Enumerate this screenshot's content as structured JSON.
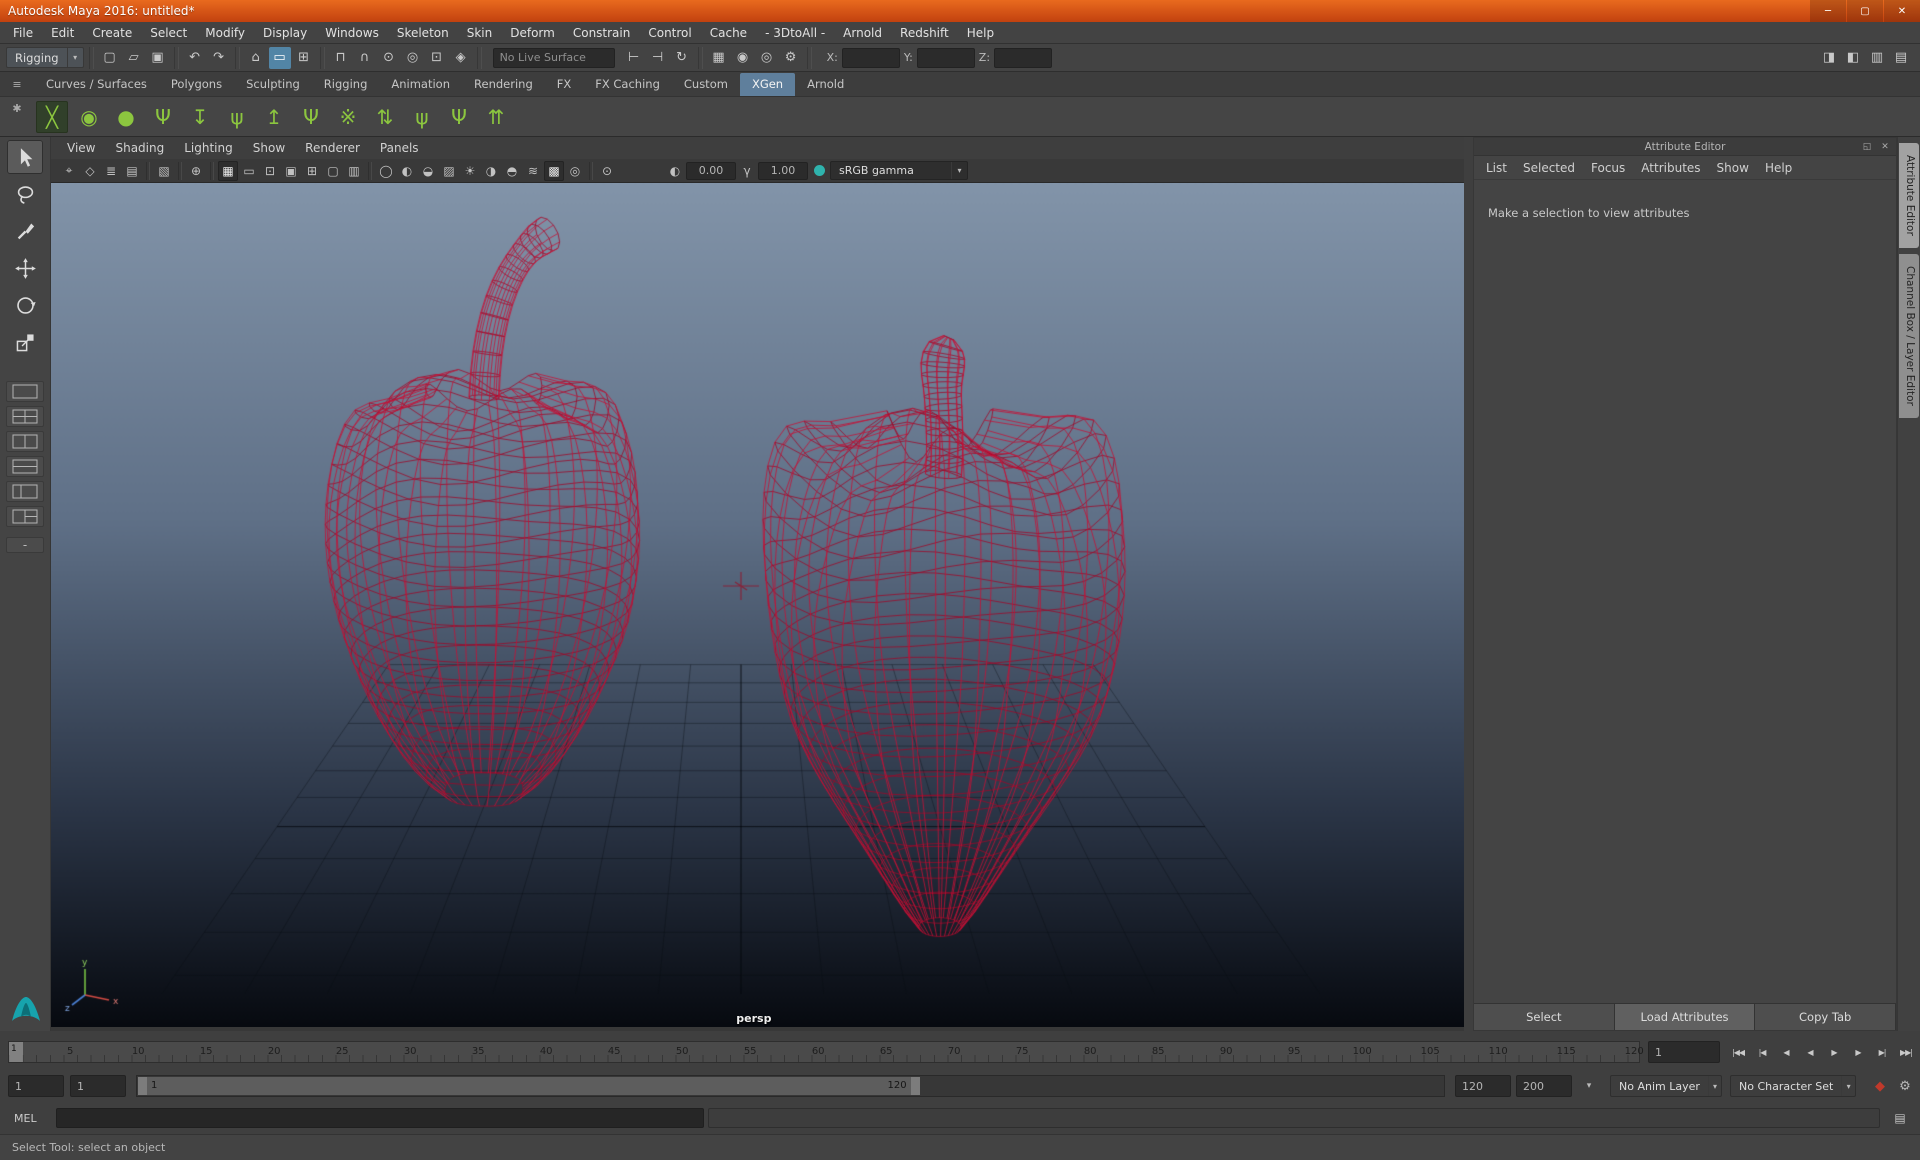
{
  "window": {
    "title": "Autodesk Maya 2016: untitled*",
    "minimize": "─",
    "maximize": "▢",
    "close": "✕"
  },
  "glyphs": {
    "chevron_down": "▾",
    "float_panel": "◱",
    "close_small": "✕",
    "shelf_menu": "≡",
    "shelf_gear": "✱"
  },
  "menubar": [
    "File",
    "Edit",
    "Create",
    "Select",
    "Modify",
    "Display",
    "Windows",
    "Skeleton",
    "Skin",
    "Deform",
    "Constrain",
    "Control",
    "Cache",
    "- 3DtoAll -",
    "Arnold",
    "Redshift",
    "Help"
  ],
  "toolbar": {
    "menuset": "Rigging",
    "groups": [
      [
        {
          "name": "new-scene-icon",
          "glyph": "▢"
        },
        {
          "name": "open-scene-icon",
          "glyph": "▱"
        },
        {
          "name": "save-scene-icon",
          "glyph": "▣"
        }
      ],
      [
        {
          "name": "undo-icon",
          "glyph": "↶"
        },
        {
          "name": "redo-icon",
          "glyph": "↷"
        }
      ],
      [
        {
          "name": "select-by-hierarchy-icon",
          "glyph": "⌂"
        },
        {
          "name": "select-by-object-icon",
          "glyph": "▭",
          "active": true
        },
        {
          "name": "select-by-component-icon",
          "glyph": "⊞"
        }
      ],
      [
        {
          "name": "snap-to-grid-icon",
          "glyph": "⊓"
        },
        {
          "name": "snap-to-curve-icon",
          "glyph": "∩"
        },
        {
          "name": "snap-to-point-icon",
          "glyph": "⊙"
        },
        {
          "name": "snap-to-projected-center-icon",
          "glyph": "◎"
        },
        {
          "name": "snap-to-view-plane-icon",
          "glyph": "⊡"
        },
        {
          "name": "make-live-icon",
          "glyph": "◈"
        }
      ]
    ],
    "live_surface": "No Live Surface",
    "groups2": [
      [
        {
          "name": "input-connections-icon",
          "glyph": "⊢"
        },
        {
          "name": "output-connections-icon",
          "glyph": "⊣"
        },
        {
          "name": "construction-history-icon",
          "glyph": "↻"
        }
      ],
      [
        {
          "name": "render-view-icon",
          "glyph": "▦"
        },
        {
          "name": "render-current-frame-icon",
          "glyph": "◉"
        },
        {
          "name": "ipr-render-icon",
          "glyph": "◎"
        },
        {
          "name": "render-settings-icon",
          "glyph": "⚙"
        }
      ]
    ],
    "coords": {
      "x_label": "X:",
      "y_label": "Y:",
      "z_label": "Z:",
      "x_value": "",
      "y_value": "",
      "z_value": ""
    },
    "right_icons": [
      {
        "name": "toggle-modeling-toolkit-icon",
        "glyph": "◨"
      },
      {
        "name": "toggle-attribute-editor-icon",
        "glyph": "◧"
      },
      {
        "name": "toggle-tool-settings-icon",
        "glyph": "▥"
      },
      {
        "name": "toggle-channel-box-icon",
        "glyph": "▤"
      }
    ]
  },
  "shelf": {
    "tabs": [
      "Curves / Surfaces",
      "Polygons",
      "Sculpting",
      "Rigging",
      "Animation",
      "Rendering",
      "FX",
      "FX Caching",
      "Custom",
      "XGen",
      "Arnold"
    ],
    "active_tab": "XGen",
    "icons": [
      {
        "name": "xgen-create-description-icon",
        "glyph": "╳",
        "boxed": true
      },
      {
        "name": "xgen-update-preview-icon",
        "glyph": "◉"
      },
      {
        "name": "xgen-sphere-brush-icon",
        "glyph": "●"
      },
      {
        "name": "xgen-add-guides-icon",
        "glyph": "Ψ"
      },
      {
        "name": "xgen-place-guides-icon",
        "glyph": "↧"
      },
      {
        "name": "xgen-comb-guides-icon",
        "glyph": "ψ"
      },
      {
        "name": "xgen-lift-guides-icon",
        "glyph": "↥"
      },
      {
        "name": "xgen-edit-guides-icon",
        "glyph": "Ψ"
      },
      {
        "name": "xgen-density-brush-icon",
        "glyph": "※"
      },
      {
        "name": "xgen-convert-to-poly-icon",
        "glyph": "⇅"
      },
      {
        "name": "xgen-grass-preset-icon",
        "glyph": "ψ"
      },
      {
        "name": "xgen-groomable-spline-icon",
        "glyph": "Ψ"
      },
      {
        "name": "xgen-export-patches-icon",
        "glyph": "⇈"
      }
    ]
  },
  "toolbox": {
    "tools": [
      {
        "name": "select-tool",
        "active": true
      },
      {
        "name": "lasso-tool"
      },
      {
        "name": "paint-selection-tool"
      },
      {
        "name": "move-tool"
      },
      {
        "name": "rotate-tool"
      },
      {
        "name": "scale-tool"
      }
    ],
    "layouts": [
      "layout-single-pane",
      "layout-four-view",
      "layout-two-side-by-side",
      "layout-two-stacked",
      "layout-persp-outliner",
      "layout-split-right"
    ],
    "collapse_label": "-"
  },
  "panel": {
    "menus": [
      "View",
      "Shading",
      "Lighting",
      "Show",
      "Renderer",
      "Panels"
    ],
    "icons": [
      {
        "name": "select-camera-icon",
        "glyph": "⌖"
      },
      {
        "name": "lock-camera-icon",
        "glyph": "◇"
      },
      {
        "name": "camera-attributes-icon",
        "glyph": "≣"
      },
      {
        "name": "bookmarks-icon",
        "glyph": "▤"
      },
      {
        "sep": true
      },
      {
        "name": "image-plane-icon",
        "glyph": "▧"
      },
      {
        "sep": true
      },
      {
        "name": "2d-pan-zoom-icon",
        "glyph": "⊕"
      },
      {
        "sep": true
      },
      {
        "name": "grid-icon",
        "glyph": "▦",
        "active": true
      },
      {
        "name": "film-gate-icon",
        "glyph": "▭"
      },
      {
        "name": "resolution-gate-icon",
        "glyph": "⊡"
      },
      {
        "name": "gate-mask-icon",
        "glyph": "▣"
      },
      {
        "name": "field-chart-icon",
        "glyph": "⊞"
      },
      {
        "name": "safe-action-icon",
        "glyph": "▢"
      },
      {
        "name": "safe-title-icon",
        "glyph": "▥"
      },
      {
        "sep": true
      },
      {
        "name": "wireframe-icon",
        "glyph": "◯"
      },
      {
        "name": "smooth-shade-icon",
        "glyph": "◐"
      },
      {
        "name": "wireframe-on-shaded-icon",
        "glyph": "◒"
      },
      {
        "name": "textured-icon",
        "glyph": "▨"
      },
      {
        "name": "use-all-lights-icon",
        "glyph": "☀"
      },
      {
        "name": "shadows-icon",
        "glyph": "◑"
      },
      {
        "name": "screen-space-ao-icon",
        "glyph": "◓"
      },
      {
        "name": "motion-blur-icon",
        "glyph": "≋"
      },
      {
        "name": "multisample-icon",
        "glyph": "▩",
        "active": true
      },
      {
        "name": "depth-of-field-icon",
        "glyph": "◎"
      },
      {
        "sep": true
      },
      {
        "name": "isolate-select-icon",
        "glyph": "⊙"
      }
    ],
    "exposure_icon": "◐",
    "exposure": "0.00",
    "gamma_icon": "γ",
    "gamma": "1.00",
    "view_transform": "sRGB gamma",
    "camera": "persp"
  },
  "attribute_editor": {
    "title": "Attribute Editor",
    "menus": [
      "List",
      "Selected",
      "Focus",
      "Attributes",
      "Show",
      "Help"
    ],
    "message": "Make a selection to view attributes",
    "buttons": [
      {
        "label": "Select"
      },
      {
        "label": "Load Attributes",
        "active": true
      },
      {
        "label": "Copy Tab"
      }
    ]
  },
  "right_tabs": [
    {
      "label": "Attribute Editor",
      "active": true
    },
    {
      "label": "Channel Box / Layer Editor"
    }
  ],
  "timeline": {
    "tick_labels": [
      "5",
      "10",
      "15",
      "20",
      "25",
      "30",
      "35",
      "40",
      "45",
      "50",
      "55",
      "60",
      "65",
      "70",
      "75",
      "80",
      "85",
      "90",
      "95",
      "100",
      "105",
      "110",
      "115",
      "120"
    ],
    "playhead": "1",
    "current_frame": "1",
    "playback": [
      {
        "name": "go-to-start-button",
        "glyph": "|◀◀"
      },
      {
        "name": "step-back-frame-button",
        "glyph": "|◀"
      },
      {
        "name": "step-back-key-button",
        "glyph": "◀"
      },
      {
        "name": "play-backwards-button",
        "glyph": "◀"
      },
      {
        "name": "play-forwards-button",
        "glyph": "▶"
      },
      {
        "name": "step-forward-key-button",
        "glyph": "▶"
      },
      {
        "name": "step-forward-frame-button",
        "glyph": "▶|"
      },
      {
        "name": "go-to-end-button",
        "glyph": "▶▶|"
      }
    ]
  },
  "range_slider": {
    "anim_start": "1",
    "playback_start": "1",
    "bar_start_label": "1",
    "bar_end_label": "120",
    "playback_end": "120",
    "anim_end": "200",
    "menu_glyph": "▾",
    "anim_layer": "No Anim Layer",
    "character_set": "No Character Set",
    "icons": [
      {
        "name": "auto-keyframe-icon",
        "glyph": "◆",
        "color": "#c0392b"
      },
      {
        "name": "animation-preferences-icon",
        "glyph": "⚙",
        "color": "#b8b8b8"
      }
    ]
  },
  "command_line": {
    "label": "MEL",
    "input_value": "",
    "result_value": "",
    "script_editor_glyph": "▤"
  },
  "help_line": "Select Tool: select an object",
  "colors": {
    "titlebar_top": "#e96a1e",
    "titlebar_bottom": "#c2410f",
    "accent_blue": "#5285a6",
    "shelf_tab_active": "#5f7f9c",
    "xgen_green": "#8cc63f",
    "wireframe_ring": "rgba(158,8,40,0.8)",
    "wireframe_long": "rgba(198,16,54,0.8)",
    "viewport_top": "#8294a9",
    "viewport_bottom": "#070a10",
    "color_management_dot": "#2fb3ad"
  }
}
